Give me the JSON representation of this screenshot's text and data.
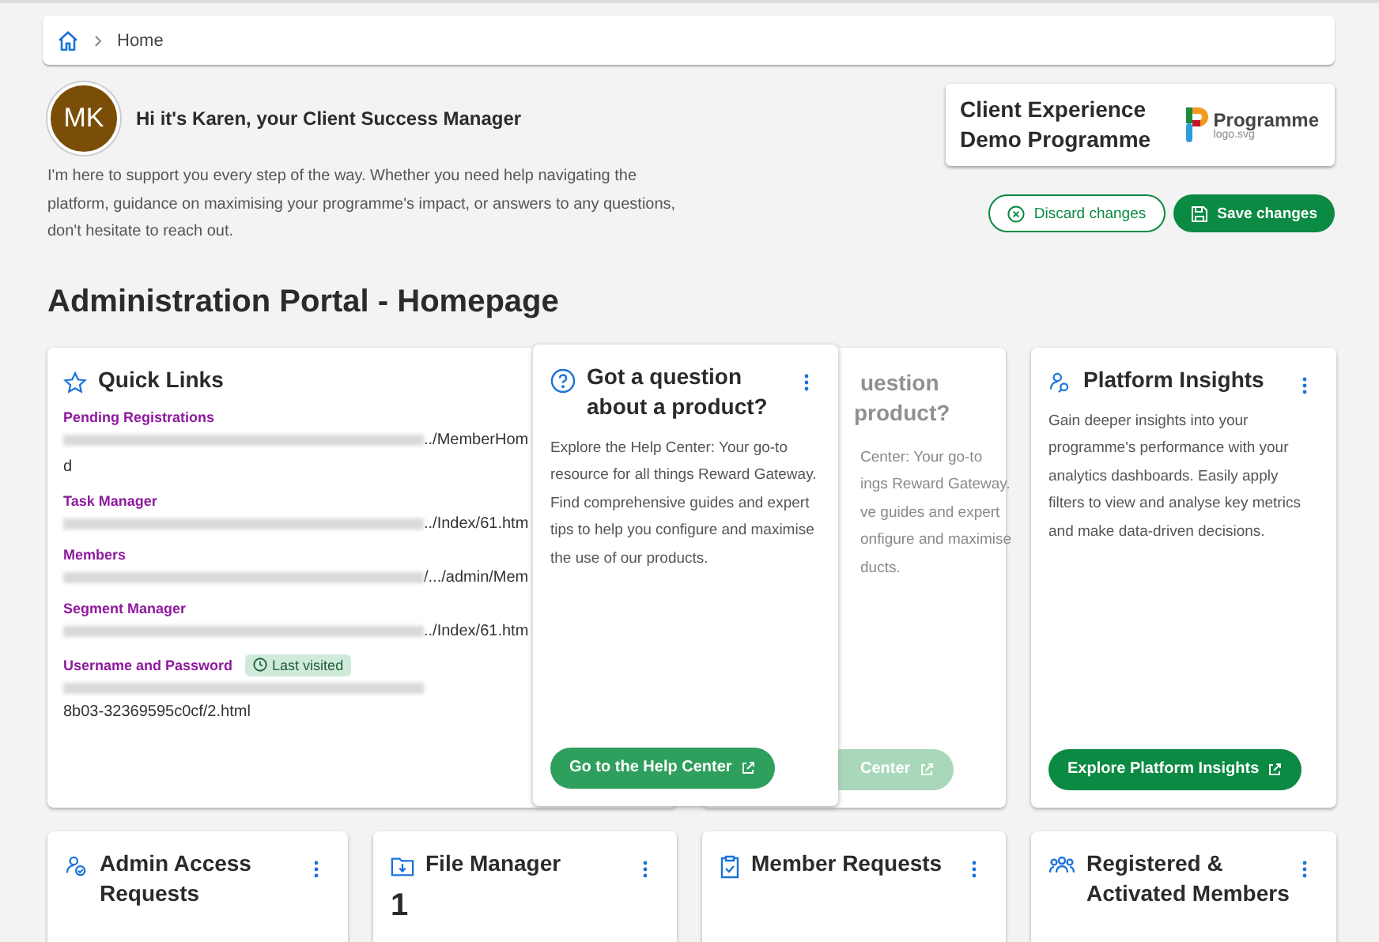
{
  "breadcrumb": {
    "items": [
      {
        "label": "Home"
      }
    ]
  },
  "csm": {
    "initials": "MK",
    "greeting": "Hi it's Karen, your Client Success Manager",
    "message": "I'm here to support you every step of the way. Whether you need help navigating the platform, guidance on maximising your programme's impact, or answers to any questions, don't hesitate to reach out."
  },
  "programme": {
    "name": "Client Experience Demo Programme",
    "logo_text": "Programme",
    "logo_caption": "logo.svg"
  },
  "actions": [
    {
      "label": "Discard changes",
      "kind": "outline"
    },
    {
      "label": "Save changes",
      "kind": "primary"
    }
  ],
  "page_title": "Administration Portal - Homepage",
  "quick_links": {
    "title": "Quick Links",
    "links": [
      {
        "label": "Pending Registrations",
        "url_tail": "../MemberHom",
        "url_continuation": "d"
      },
      {
        "label": "Task Manager",
        "url_tail": "../Index/61.htm"
      },
      {
        "label": "Members",
        "url_tail": "/.../admin/Mem"
      },
      {
        "label": "Segment Manager",
        "url_tail": "../Index/61.htm"
      },
      {
        "label": "Username and Password",
        "badge": "Last visited",
        "url_continuation": "8b03-32369595c0cf/2.html"
      }
    ]
  },
  "help_card": {
    "title_lines": [
      "uestion",
      "product?"
    ],
    "body_lines": [
      "Center: Your go-to",
      "ings Reward Gateway.",
      "ve guides and expert",
      "onfigure and maximise",
      "ducts."
    ],
    "button": "Center"
  },
  "dragged_card": {
    "title": "Got a question about a product?",
    "body": "Explore the Help Center: Your go-to resource for all things Reward Gateway. Find comprehensive guides and expert tips to help you configure and maximise the use of our products.",
    "button": "Go to the Help Center"
  },
  "insights_card": {
    "title": "Platform Insights",
    "body": "Gain deeper insights into your programme's performance with your analytics dashboards. Easily apply filters to view and analyse key metrics and make data-driven decisions.",
    "button": "Explore Platform Insights"
  },
  "bottom_cards": [
    {
      "title": "Admin Access Requests"
    },
    {
      "title": "File Manager",
      "value": "1"
    },
    {
      "title": "Member Requests"
    },
    {
      "title": "Registered & Activated Members"
    }
  ]
}
